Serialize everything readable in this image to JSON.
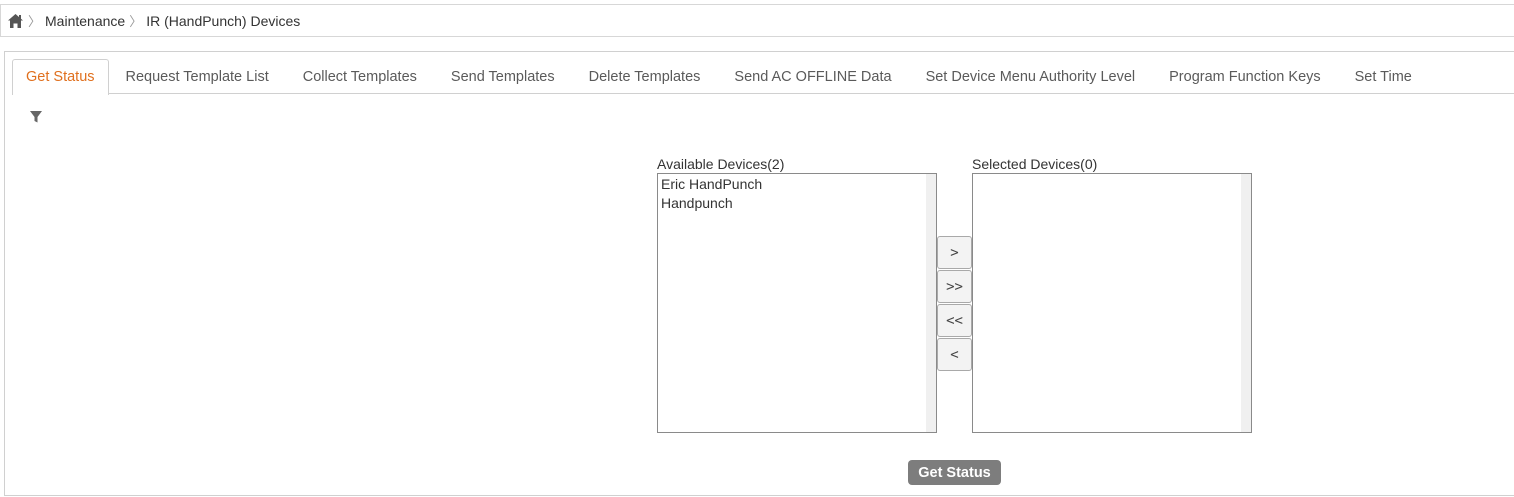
{
  "breadcrumb": {
    "home_icon": "home-icon",
    "items": [
      "Maintenance",
      "IR (HandPunch) Devices"
    ]
  },
  "tabs": [
    {
      "label": "Get Status",
      "active": true
    },
    {
      "label": "Request Template List",
      "active": false
    },
    {
      "label": "Collect Templates",
      "active": false
    },
    {
      "label": "Send Templates",
      "active": false
    },
    {
      "label": "Delete Templates",
      "active": false
    },
    {
      "label": "Send AC OFFLINE Data",
      "active": false
    },
    {
      "label": "Set Device Menu Authority Level",
      "active": false
    },
    {
      "label": "Program Function Keys",
      "active": false
    },
    {
      "label": "Set Time",
      "active": false
    }
  ],
  "filter_icon": "filter-icon",
  "available": {
    "label": "Available Devices(2)",
    "items": [
      "Eric HandPunch",
      "Handpunch"
    ]
  },
  "selected": {
    "label": "Selected Devices(0)",
    "items": []
  },
  "move_buttons": {
    "move_one_right": ">",
    "move_all_right": ">>",
    "move_all_left": "<<",
    "move_one_left": "<"
  },
  "action_button": "Get Status",
  "colors": {
    "active_tab": "#e0701e",
    "action_button_bg": "#7d7d7d",
    "border": "#d0d0d0"
  }
}
